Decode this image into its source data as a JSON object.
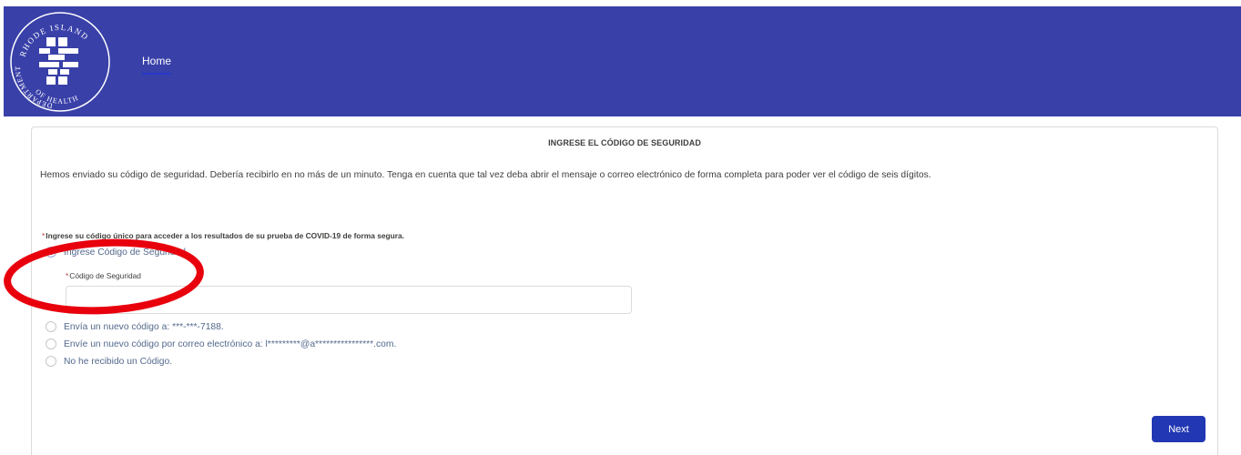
{
  "header": {
    "logo_text_top": "RHODE ISLAND",
    "logo_text_left": "DEPARTMENT",
    "logo_text_bottom": "OF HEALTH",
    "nav_home": "Home",
    "background_color": "#3940a8"
  },
  "form": {
    "title": "INGRESE EL CÓDIGO DE SEGURIDAD",
    "instructions": "Hemos enviado su código de seguridad. Debería recibirlo en no más de un minuto. Tenga en cuenta que tal vez deba abrir el mensaje o correo electrónico de forma completa para poder ver el código de seis dígitos.",
    "required_star": "*",
    "required_label": "Ingrese su código único para acceder a los resultados de su prueba de COVID-19 de forma segura.",
    "options": [
      {
        "label": "Ingrese Código de Seguridad",
        "selected": true
      },
      {
        "label": "Envía un nuevo código a: ***-***-7188.",
        "selected": false
      },
      {
        "label": "Envíe un nuevo código por correo electrónico a: l*********@a****************.com.",
        "selected": false
      },
      {
        "label": "No he recibido un Código.",
        "selected": false
      }
    ],
    "code_field": {
      "required_star": "*",
      "label": "Código de Seguridad",
      "value": "",
      "placeholder": ""
    },
    "next_label": "Next",
    "accent_color": "#2137b3",
    "annotation_color": "#e8000d"
  }
}
